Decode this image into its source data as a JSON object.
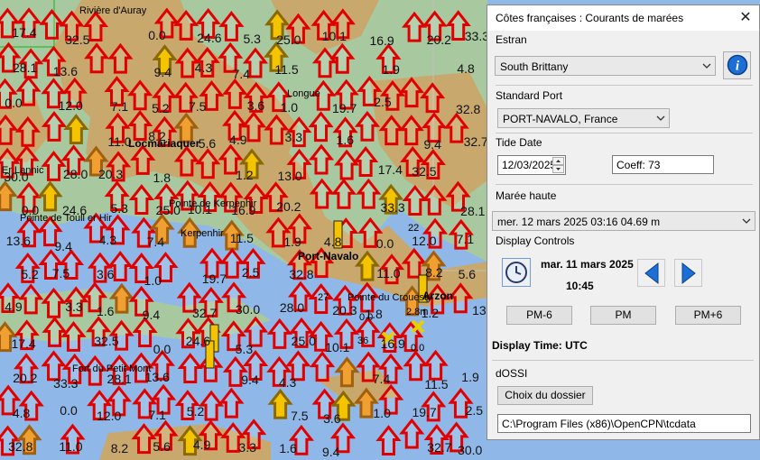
{
  "map": {
    "places": [
      {
        "text": "Rivière d'Auray"
      },
      {
        "text": "Locmariaquer"
      },
      {
        "text": "Pointe de Kerpenhir"
      },
      {
        "text": "Pointe de Toull er Hir"
      },
      {
        "text": "Port-Navalo"
      },
      {
        "text": "Arzon"
      },
      {
        "text": "Longue"
      },
      {
        "text": "Pointe du Crouesty"
      },
      {
        "text": "Er Lannic"
      },
      {
        "text": "Fort du Petit Mont"
      },
      {
        "text": "Kerpenhir"
      }
    ],
    "current_values": [
      "17.4",
      "32.5",
      "0.0",
      "24.6",
      "5.3",
      "25.0",
      "10.1",
      "16.9",
      "20.2",
      "33.3",
      "28.1",
      "13.6",
      "9.4",
      "4.3",
      "7.4",
      "11.5",
      "1.9",
      "4.8",
      "0.0",
      "12.0",
      "7.1",
      "5.2",
      "7.5",
      "3.6",
      "1.0",
      "19.7",
      "2.5",
      "32.8",
      "11.0",
      "8.2",
      "5.6",
      "4.9",
      "3.3",
      "1.6",
      "9.4",
      "32.7",
      "30.0",
      "28.0",
      "20.3",
      "1.8",
      "1.2",
      "13.0"
    ],
    "depth_marks": [
      "22",
      "27",
      "36",
      "2.8m",
      "0.0",
      "0.0"
    ]
  },
  "dialog": {
    "title": "Côtes françaises : Courants de marées",
    "close_label": "✕",
    "estran_group": "Estran",
    "estran_value": "South Brittany",
    "info_label": "i",
    "standard_port_group": "Standard Port",
    "standard_port_value": "PORT-NAVALO, France",
    "tide_date_group": "Tide Date",
    "tide_date_value": "12/03/2025",
    "coeff_text": "Coeff:   73",
    "maree_haute_group": "Marée haute",
    "maree_haute_value": "mer. 12 mars 2025  03:16  04.69 m",
    "display_controls_group": "Display Controls",
    "display_date": "mar. 11 mars 2025",
    "display_time": "10:45",
    "btn_pm_minus": "PM-6",
    "btn_pm": "PM",
    "btn_pm_plus": "PM+6",
    "display_time_label": "Display Time: UTC",
    "dossi_group": "dOSSI",
    "choose_folder_label": "Choix du dossier",
    "folder_path": "C:\\Program Files (x86)\\OpenCPN\\tcdata"
  },
  "colors": {
    "land": "#c8a86c",
    "shallow": "#a8c8a0",
    "deep": "#8fb8e8",
    "arrow_red": "#e00000",
    "arrow_orange": "#f0a030",
    "arrow_yellow": "#f5c400",
    "dialog_bg": "#f0f0f0",
    "accent_blue": "#1c6fd6"
  }
}
